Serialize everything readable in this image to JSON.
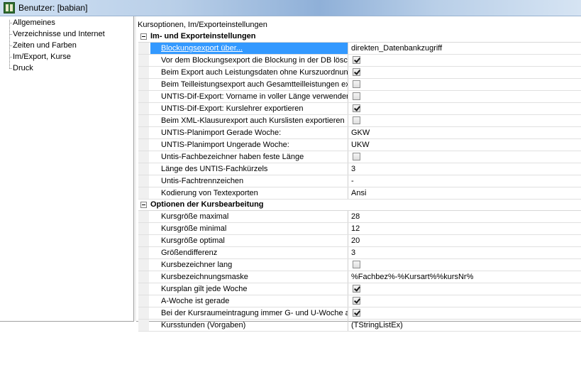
{
  "window": {
    "title": "Benutzer: [babian]"
  },
  "tree": {
    "items": [
      {
        "label": "Allgemeines"
      },
      {
        "label": "Verzeichnisse und Internet"
      },
      {
        "label": "Zeiten und Farben"
      },
      {
        "label": "Im/Export, Kurse"
      },
      {
        "label": "Druck"
      }
    ]
  },
  "main": {
    "caption": "Kursoptionen, Im/Exporteinstellungen",
    "sections": [
      {
        "title": "Im- und Exporteinstellungen",
        "rows": [
          {
            "name": "Blockungsexport über...",
            "value": "direkten_Datenbankzugriff"
          },
          {
            "name": "Vor dem Blockungsexport die Blockung in der DB löschen",
            "checked": true
          },
          {
            "name": "Beim Export auch Leistungsdaten ohne Kurszuordnung exportieren",
            "checked": true
          },
          {
            "name": "Beim Teilleistungsexport auch Gesamtteilleistungen exportieren",
            "checked": false
          },
          {
            "name": "UNTIS-Dif-Export: Vorname in voller Länge verwenden",
            "checked": false
          },
          {
            "name": "UNTIS-Dif-Export:  Kurslehrer exportieren",
            "checked": true
          },
          {
            "name": "Beim XML-Klausurexport auch Kurslisten exportieren",
            "checked": false
          },
          {
            "name": "UNTIS-Planimport Gerade Woche:",
            "value": "GKW"
          },
          {
            "name": "UNTIS-Planimport Ungerade Woche:",
            "value": "UKW"
          },
          {
            "name": "Untis-Fachbezeichner haben feste Länge",
            "checked": false
          },
          {
            "name": "Länge des UNTIS-Fachkürzels",
            "value": "3"
          },
          {
            "name": "Untis-Fachtrennzeichen",
            "value": "-"
          },
          {
            "name": "Kodierung von Textexporten",
            "value": "Ansi"
          }
        ]
      },
      {
        "title": "Optionen der Kursbearbeitung",
        "rows": [
          {
            "name": "Kursgröße maximal",
            "value": "28"
          },
          {
            "name": "Kursgröße minimal",
            "value": "12"
          },
          {
            "name": "Kursgröße optimal",
            "value": "20"
          },
          {
            "name": "Größendifferenz",
            "value": "3"
          },
          {
            "name": "Kursbezeichner lang",
            "checked": false
          },
          {
            "name": "Kursbezeichnungsmaske",
            "value": "%Fachbez%-%Kursart%%kursNr%"
          },
          {
            "name": "Kursplan gilt jede Woche",
            "checked": true
          },
          {
            "name": "A-Woche ist gerade",
            "checked": true
          },
          {
            "name": "Bei der Kursraumeintragung immer G- und U-Woche anzeigen",
            "checked": true
          },
          {
            "name": "Kursstunden (Vorgaben)",
            "value": "(TStringListEx)"
          }
        ]
      }
    ]
  }
}
